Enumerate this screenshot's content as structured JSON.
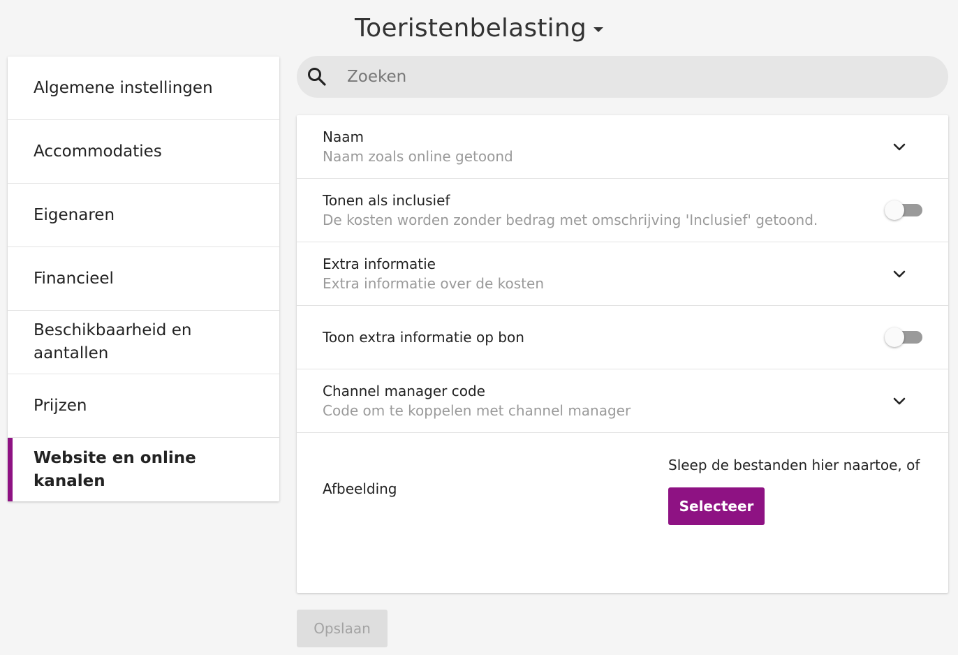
{
  "header": {
    "title": "Toeristenbelasting"
  },
  "sidebar": {
    "items": [
      {
        "label": "Algemene instellingen"
      },
      {
        "label": "Accommodaties"
      },
      {
        "label": "Eigenaren"
      },
      {
        "label": "Financieel"
      },
      {
        "label": "Beschikbaarheid en aantallen"
      },
      {
        "label": "Prijzen"
      },
      {
        "label": "Website en online kanalen",
        "active": true
      }
    ]
  },
  "search": {
    "placeholder": "Zoeken",
    "value": ""
  },
  "settings": {
    "rows": [
      {
        "title": "Naam",
        "subtitle": "Naam zoals online getoond",
        "control": "chevron-down-icon"
      },
      {
        "title": "Tonen als inclusief",
        "subtitle": "De kosten worden zonder bedrag met omschrijving 'Inclusief' getoond.",
        "control": "toggle",
        "on": false
      },
      {
        "title": "Extra informatie",
        "subtitle": "Extra informatie over de kosten",
        "control": "chevron-down-icon"
      },
      {
        "title": "Toon extra informatie op bon",
        "control": "toggle",
        "on": false
      },
      {
        "title": "Channel manager code",
        "subtitle": "Code om te koppelen met channel manager",
        "control": "chevron-down-icon"
      }
    ],
    "image": {
      "label": "Afbeelding",
      "drop_text": "Sleep de bestanden hier naartoe, of",
      "select_label": "Selecteer"
    }
  },
  "footer": {
    "save_label": "Opslaan"
  },
  "colors": {
    "accent": "#8e1283",
    "background": "#f5f5f5",
    "toggle_off": "#9a9a9a"
  }
}
